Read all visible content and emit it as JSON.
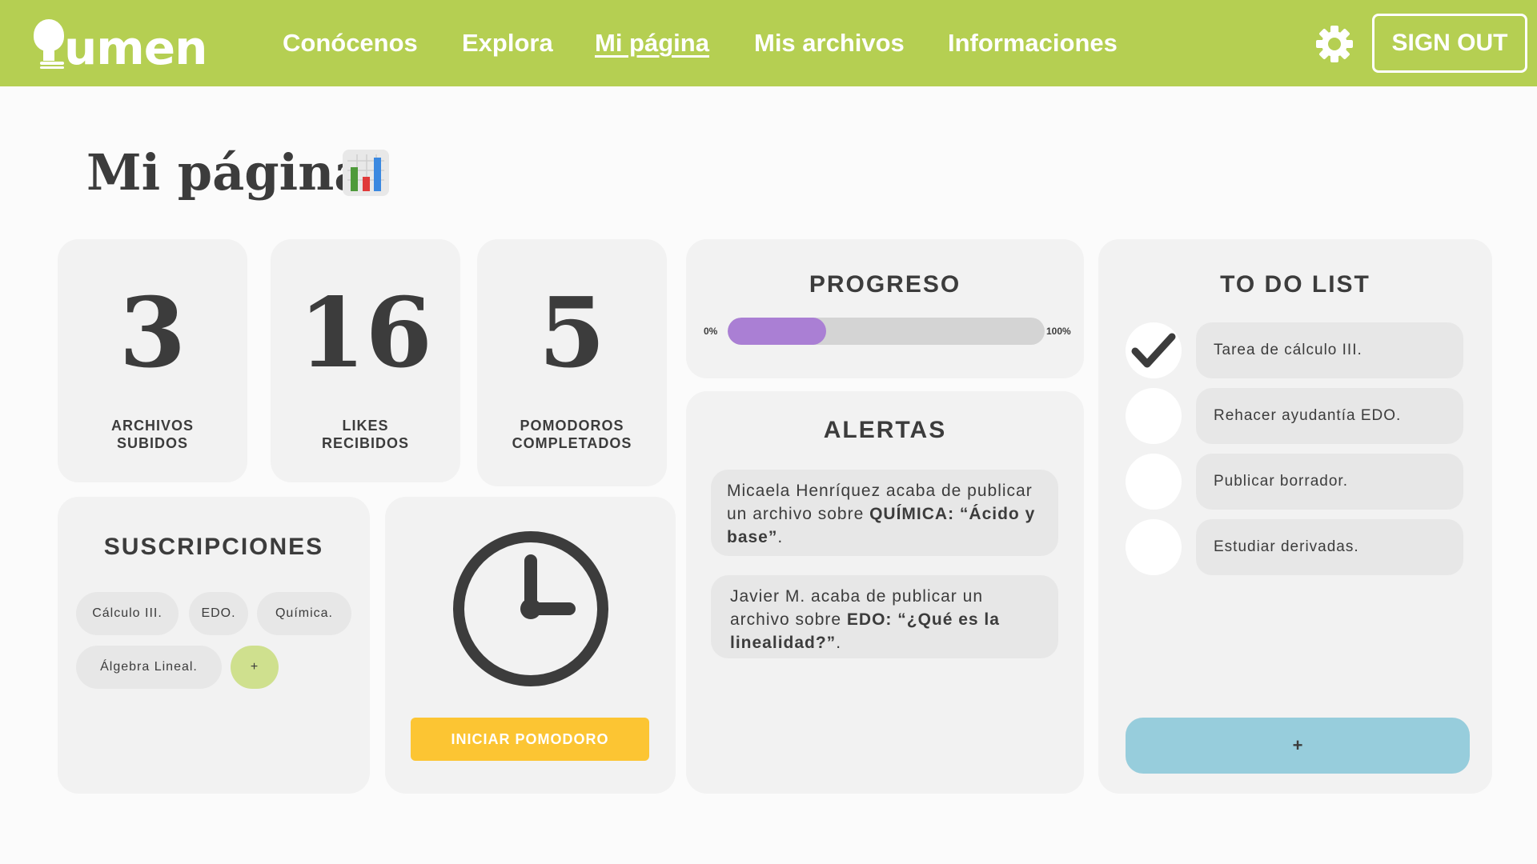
{
  "nav": {
    "logo_text": "umen",
    "links": [
      "Conócenos",
      "Explora",
      "Mi página",
      "Mis archivos",
      "Informaciones"
    ],
    "active_link": "Mi página",
    "signout_label": "SIGN OUT",
    "settings_icon": "gear-icon"
  },
  "page": {
    "title": "Mi página",
    "title_icon": "bar-chart-icon"
  },
  "stats": [
    {
      "value": "3",
      "label_line1": "ARCHIVOS",
      "label_line2": "SUBIDOS"
    },
    {
      "value": "16",
      "label_line1": "LIKES",
      "label_line2": "RECIBIDOS"
    },
    {
      "value": "5",
      "label_line1": "POMODOROS",
      "label_line2": "COMPLETADOS"
    }
  ],
  "progress": {
    "title": "PROGRESO",
    "min_label": "0%",
    "max_label": "100%",
    "value_fraction": 0.31
  },
  "alerts": {
    "title": "ALERTAS",
    "items": [
      {
        "pre": "Micaela Henríquez acaba de publicar un archivo sobre ",
        "bold": "QUÍMICA: “Ácido y base”",
        "post": "."
      },
      {
        "pre": "Javier M. acaba de publicar un archivo sobre ",
        "bold": "EDO: “¿Qué es la linealidad?”",
        "post": "."
      }
    ]
  },
  "todo": {
    "title": "TO DO LIST",
    "items": [
      {
        "label": "Tarea de cálculo III.",
        "done": true
      },
      {
        "label": "Rehacer ayudantía EDO.",
        "done": false
      },
      {
        "label": "Publicar borrador.",
        "done": false
      },
      {
        "label": "Estudiar derivadas.",
        "done": false
      }
    ],
    "add_label": "+"
  },
  "subscriptions": {
    "title": "SUSCRIPCIONES",
    "chips": [
      "Cálculo III.",
      "EDO.",
      "Química.",
      "Álgebra Lineal."
    ],
    "add_label": "+"
  },
  "pomodoro": {
    "button_label": "INICIAR POMODORO",
    "icon": "clock-icon"
  },
  "colors": {
    "nav_bg": "#b5cf52",
    "card_bg": "#f2f2f2",
    "progress_fill": "#aa7fd4",
    "pomodoro_button": "#fcc533",
    "todo_add": "#97cddc",
    "chip_add": "#cfe08e",
    "text": "#3c3c3c"
  }
}
